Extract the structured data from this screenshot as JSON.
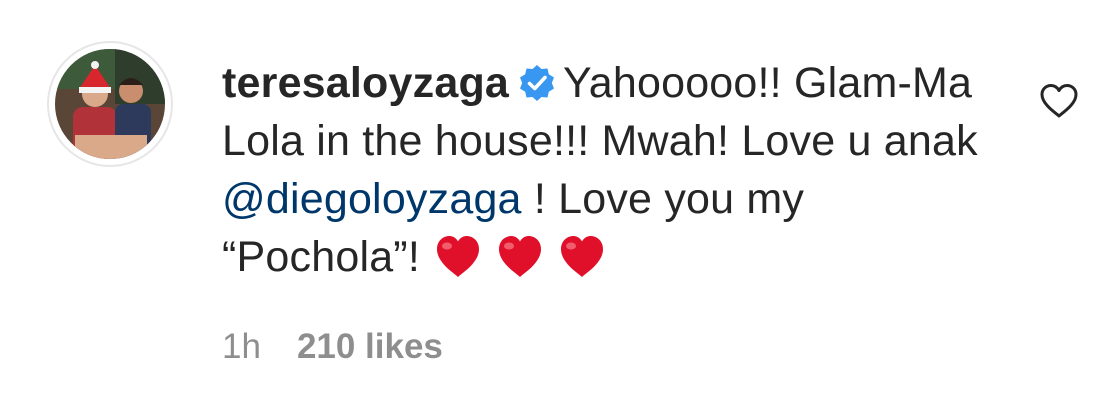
{
  "comment": {
    "username": "teresaloyzaga",
    "verified": true,
    "text_part1": "Yahooooo!! Glam-Ma Lola in the house!!! Mwah! Love u anak ",
    "mention": "@diegoloyzaga",
    "text_part2": " ! Love you my “Pochola”!",
    "emoji": [
      "heart-emoji",
      "heart-emoji",
      "heart-emoji"
    ],
    "timestamp": "1h",
    "likes": "210 likes"
  },
  "colors": {
    "text": "#262626",
    "mention": "#00376b",
    "meta": "#8e8e8e",
    "verified": "#3897f0",
    "heart": "#e0102b"
  },
  "icons": {
    "like": "heart-outline-icon",
    "verified": "verified-badge-icon"
  }
}
